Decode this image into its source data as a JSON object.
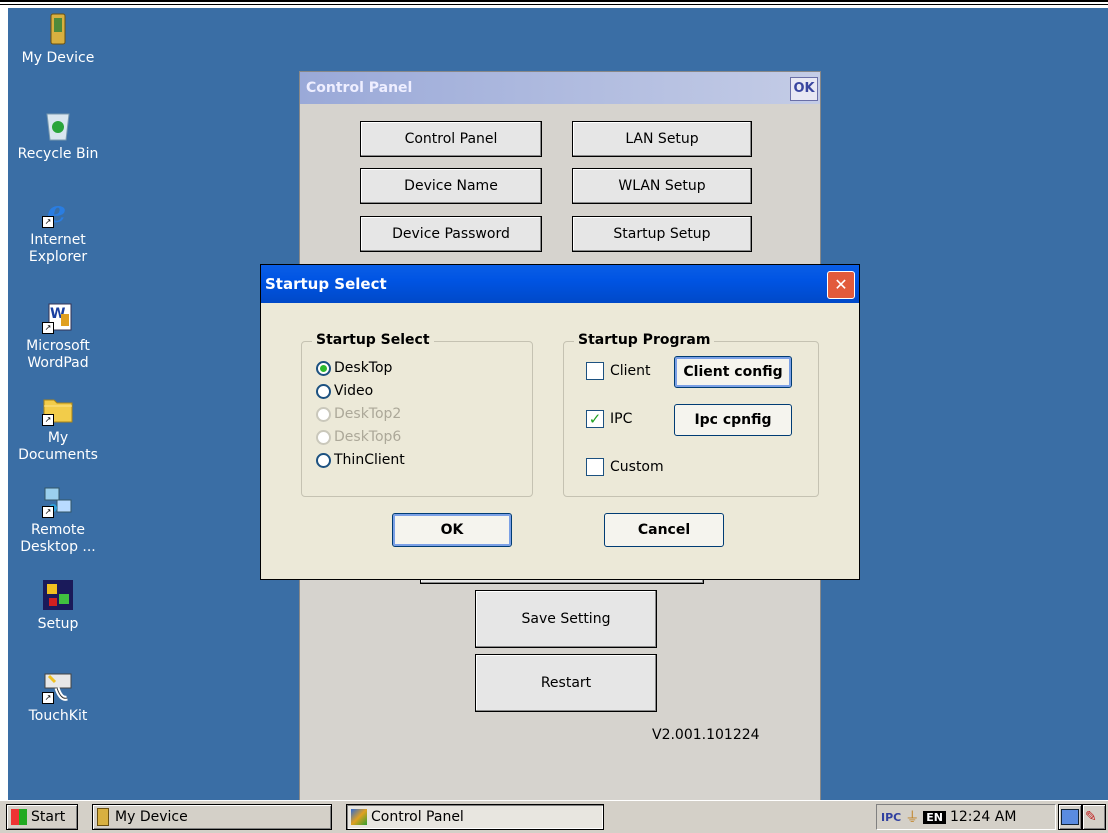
{
  "desktop": {
    "icons": [
      {
        "label": "My Device"
      },
      {
        "label": "Recycle Bin"
      },
      {
        "label": "Internet Explorer"
      },
      {
        "label": "Microsoft WordPad"
      },
      {
        "label": "My Documents"
      },
      {
        "label": "Remote Desktop ..."
      },
      {
        "label": "Setup"
      },
      {
        "label": "TouchKit"
      }
    ]
  },
  "control_panel": {
    "title": "Control Panel",
    "ok_label": "OK",
    "buttons": {
      "control_panel": "Control Panel",
      "lan_setup": "LAN Setup",
      "device_name": "Device Name",
      "wlan_setup": "WLAN Setup",
      "device_password": "Device Password",
      "startup_setup": "Startup Setup",
      "save_setting": "Save Setting",
      "restart": "Restart"
    },
    "version": "V2.001.101224"
  },
  "dialog": {
    "title": "Startup Select",
    "startup_select": {
      "label": "Startup Select",
      "selected": "DeskTop",
      "options": [
        "DeskTop",
        "Video",
        "DeskTop2",
        "DeskTop6",
        "ThinClient"
      ]
    },
    "startup_program": {
      "label": "Startup Program",
      "client": {
        "label": "Client",
        "checked": false
      },
      "client_config": "Client config",
      "ipc": {
        "label": "IPC",
        "checked": true
      },
      "ipc_config": "Ipc cpnfig",
      "custom": {
        "label": "Custom",
        "checked": false
      }
    },
    "ok": "OK",
    "cancel": "Cancel"
  },
  "taskbar": {
    "start": "Start",
    "tasks": [
      "My Device",
      "Control Panel"
    ],
    "tray_lang": "EN",
    "tray_ipc": "IPC",
    "clock": "12:24 AM"
  },
  "colors": {
    "desktop": "#3a6ea5",
    "dialog_title": "#0054e3",
    "window_bg": "#d6d3ce"
  }
}
